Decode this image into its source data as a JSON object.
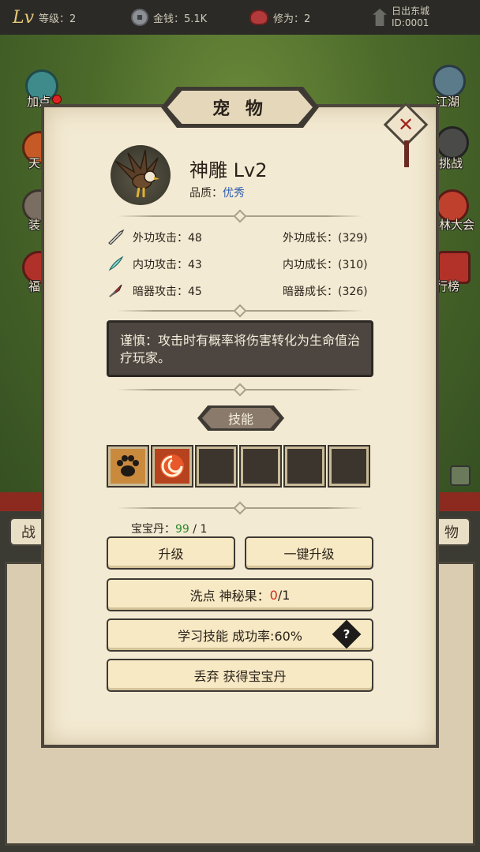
{
  "topbar": {
    "level_label": "等级：2",
    "gold_label": "金钱：5.1K",
    "cultivation_label": "修为：2",
    "location": "日出东城",
    "player_id": "ID:0001"
  },
  "side_menu": {
    "left": [
      "加点",
      "天",
      "装",
      "福"
    ],
    "right": [
      "江湖",
      "挑战",
      "林大会",
      "行榜"
    ]
  },
  "bottom_tabs": {
    "left": "战",
    "right": "物"
  },
  "modal": {
    "title": "宠 物",
    "pet": {
      "name": "神雕 Lv2",
      "quality_label": "品质：",
      "quality_value": "优秀"
    },
    "stats": [
      {
        "icon": "sword-icon",
        "label": "外功攻击：48",
        "growth": "外功成长：(329)"
      },
      {
        "icon": "feather-blade-icon",
        "label": "内功攻击：43",
        "growth": "内功成长：(310)"
      },
      {
        "icon": "dart-icon",
        "label": "暗器攻击：45",
        "growth": "暗器成长：(326)"
      }
    ],
    "description": "谨慎：攻击时有概率将伤害转化为生命值治疗玩家。",
    "skills_heading": "技能",
    "skill_slots": [
      "paw-icon",
      "fire-swirl-icon",
      "",
      "",
      "",
      ""
    ],
    "pet_pill": {
      "label": "宝宝丹：",
      "current": "99",
      "sep": " / ",
      "required": "1"
    },
    "buttons": {
      "upgrade": "升级",
      "one_click_upgrade": "一键升级",
      "reset_prefix": "洗点 神秘果：",
      "reset_current": "0",
      "reset_sep": " / ",
      "reset_required": "1",
      "learn_skill": "学习技能 成功率:60%",
      "discard": "丢弃 获得宝宝丹"
    }
  },
  "colors": {
    "panel_bg": "#f3ead3",
    "border": "#4c463b",
    "quality_blue": "#2e5fb0",
    "amount_green": "#2d8a2d",
    "amount_red": "#d0281e"
  }
}
